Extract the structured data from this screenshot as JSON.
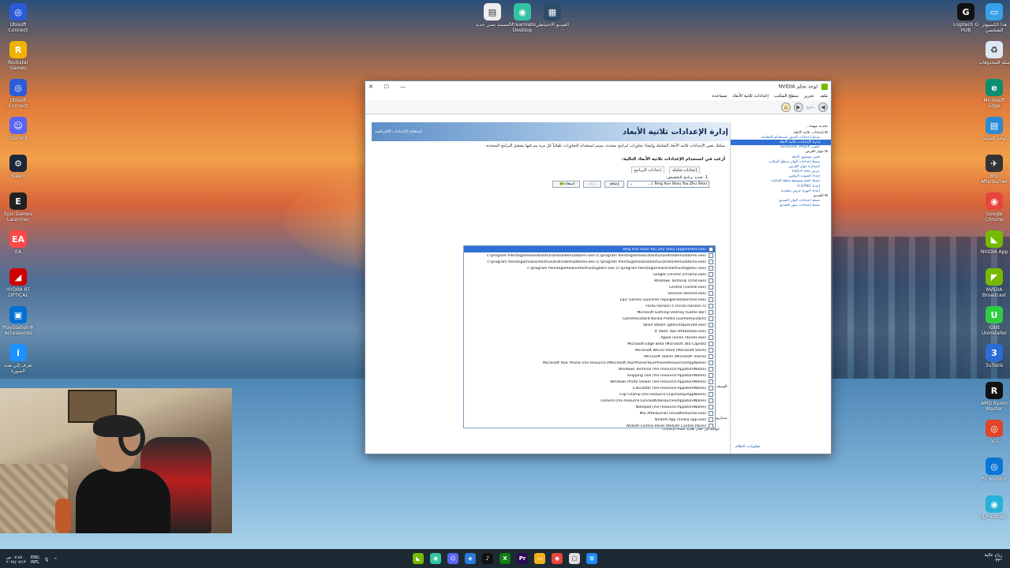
{
  "window": {
    "title": "NVIDIA لوحة تحكم",
    "menu": [
      "ملف",
      "تحرير",
      "سطح المكتب",
      "إعدادات ثلاثية الأبعاد",
      "مساعدة"
    ],
    "toolbar_back": "رجوع",
    "right_pane": {
      "header": "تحديد مهمة...",
      "tree": [
        {
          "label": "إعدادات ثلاثية الأبعاد",
          "type": "cat"
        },
        {
          "label": "ضبط إعدادات الصور باستخدام المعاينة",
          "type": "link"
        },
        {
          "label": "إدارة الإعدادات ثلاثية الأبعاد",
          "type": "sel"
        },
        {
          "label": "تكوين Surround, PhysX",
          "type": "link"
        },
        {
          "label": "جهاز العرض",
          "type": "cat"
        },
        {
          "label": "تغيير مستوى الدقة",
          "type": "link"
        },
        {
          "label": "ضبط إعدادات ألوان سطح المكتب",
          "type": "link"
        },
        {
          "label": "استدارة جهاز العرض",
          "type": "link"
        },
        {
          "label": "عرض حالة HDCP",
          "type": "link"
        },
        {
          "label": "إعداد الصوت الرقمي",
          "type": "link"
        },
        {
          "label": "ضبط حجم وموضع سطح المكتب",
          "type": "link"
        },
        {
          "label": "إعداد G-SYNC",
          "type": "link"
        },
        {
          "label": "إعداد أجهزة عرض متعددة",
          "type": "link"
        },
        {
          "label": "الفيديو",
          "type": "cat"
        },
        {
          "label": "ضبط إعدادات ألوان الفيديو",
          "type": "link"
        },
        {
          "label": "ضبط إعدادات صور الفيديو",
          "type": "link"
        }
      ],
      "system_info": "معلومات النظام"
    },
    "main": {
      "title": "إدارة الإعدادات ثلاثية الأبعاد",
      "restore": "استعادة الإعدادات الافتراضية",
      "description": "يمكنك تغيير الإعدادات ثلاثية الأبعاد الشاملة وإنشاء تجاوزات لبرامج محددة. سيتم استخدام التجاوزات تلقائياً كل مرة يتم فيها تشغيل البرامج المحددة.",
      "question": "أرغب في استخدام الإعدادات ثلاثية الأبعاد التالية:",
      "tabs": [
        "إعدادات شاملة",
        "إعدادات البرنامج"
      ],
      "step1": "1. تحديد برنامج للتخصيص:",
      "selected_program": "Teng Xun Shou You Zhu Shou (...",
      "buttons": {
        "add": "إضافة",
        "remove": "إزالة",
        "restore": "استعادة"
      },
      "side_labels": {
        "desc": "الوصف:",
        "scenario": "سيناريوهات نموذجية:",
        "hint": "لتوجيه في خلال تحديد عمدة الإعدادات."
      },
      "programs": [
        "Teng Xun Shou You Zhu Shou (appmarket.exe)",
        "c:\\program files\\txgameassistant\\ui\\androidemulatoren.exe (c:\\program files\\txgameassistant\\ui\\androidemulatoren.exe)",
        "c:\\program files\\txgameassistant\\ui\\androidemulatorex.exe (c:\\program files\\txgameassistant\\ui\\androidemulatorex.exe)",
        "c:\\program files\\txgameassistant\\ui\\txgadcc.exe (c:\\program files\\txgameassistant\\ui\\txgadcc.exe)",
        "Google Chrome (chrome.exe)",
        "Windows Terminal (cmd.exe)",
        "Control (control.exe)",
        "Discord (discord.exe)",
        "Epic Games Launcher (epicgameslauncher.exe)",
        "Forza Horizon 5 (Forza Horizon 5)",
        "Microsoft Gaming Overlay (Game Bar)",
        "GameAssistant Nvidia Profile (GameAssistant)",
        "Valve Steam (gldriverquery64.exe)",
        "It Takes Two (ittakestwo.exe)",
        "Apple iTunes (itunes.exe)",
        "Microsoft Edge Beta (Microsoft 365 Copilot)",
        "Microsoft Win10 Store (Microsoft Store)",
        "Microsoft Teams (Microsoft Teams)",
        "Microsoft Your Phone (ms-resource://Microsoft.YourPhone/YourPhone/Resources/AppName)",
        "Windows Terminal (ms-resource:AppStoreName)",
        "Snipping Tool (ms-resource:AppStoreName)",
        "Windows Photo Viewer (ms-resource:AppStoreName)",
        "Calculator (ms-resource:AppStoreName)",
        "Clip Champ (ms-resource:Clipchamp/AppName)",
        "Camera (ms-resource:LensSDK/Resources/AppStoreName)",
        "Notepad (ms-resource:AppStoreName)",
        "MSI Afterburner (msiafterburner.exe)",
        "NVIDIA App (nvidia app.exe)",
        "NVIDIA Control Panel (NVIDIA Control Panel)"
      ]
    }
  },
  "desktop_left": [
    {
      "label": "Ubisoft Connect",
      "icon": "ubisoft-icon",
      "color": "#2b5bd7",
      "glyph": "◎"
    },
    {
      "label": "Rockstar Games",
      "icon": "rockstar-icon",
      "color": "#f2b300",
      "glyph": "R"
    },
    {
      "label": "Ubisoft Connect",
      "icon": "ubisoft-icon",
      "color": "#2b5bd7",
      "glyph": "◎"
    },
    {
      "label": "Discord",
      "icon": "discord-icon",
      "color": "#5865f2",
      "glyph": "☺"
    },
    {
      "label": "Steam",
      "icon": "steam-icon",
      "color": "#1b2838",
      "glyph": "⚙"
    },
    {
      "label": "Epic Games Launcher",
      "icon": "epic-icon",
      "color": "#222",
      "glyph": "E"
    },
    {
      "label": "EA",
      "icon": "ea-icon",
      "color": "#ff4747",
      "glyph": "EA"
    },
    {
      "label": "HYDRA RT OPTICAL",
      "icon": "hydra-icon",
      "color": "#c00",
      "glyph": "◢"
    },
    {
      "label": "PlayStation® Accessories",
      "icon": "playstation-icon",
      "color": "#0070d1",
      "glyph": "▣"
    },
    {
      "label": "تعرف إلى هذه الصورة",
      "icon": "spotlight-icon",
      "color": "#1e90ff",
      "glyph": "i"
    }
  ],
  "desktop_top": [
    {
      "label": "مستند نصي جديد",
      "icon": "document-icon",
      "color": "#eee",
      "glyph": "▤"
    },
    {
      "label": "Streamlabs Desktop",
      "icon": "streamlabs-icon",
      "color": "#31c3a2",
      "glyph": "◉"
    },
    {
      "label": "الفيديو الاحتياطي",
      "icon": "video-icon",
      "color": "#2d4b6b",
      "glyph": "▦"
    }
  ],
  "desktop_right": [
    {
      "label": "هذا الكمبيوتر الشخصي",
      "icon": "pc-icon",
      "color": "#3aa0e8",
      "glyph": "▭"
    },
    {
      "label": "Logitech G HUB",
      "icon": "logitech-icon",
      "color": "#111",
      "glyph": "G"
    },
    {
      "label": "سلة المحذوفات",
      "icon": "recycle-bin-icon",
      "color": "#dde8f2",
      "glyph": "♻"
    },
    {
      "label": "Microsoft Edge",
      "icon": "edge-icon",
      "color": "#0c8f6e",
      "glyph": "e"
    },
    {
      "label": "لوحة التحكم",
      "icon": "control-panel-icon",
      "color": "#2a8bd5",
      "glyph": "▤"
    },
    {
      "label": "MSI Afterburner",
      "icon": "afterburner-icon",
      "color": "#333",
      "glyph": "✈"
    },
    {
      "label": "Google Chrome",
      "icon": "chrome-icon",
      "color": "#e8453c",
      "glyph": "◉"
    },
    {
      "label": "NVIDIA App",
      "icon": "nvidia-icon",
      "color": "#76b900",
      "glyph": "◣"
    },
    {
      "label": "NVIDIA Broadcast",
      "icon": "nvidia-broadcast-icon",
      "color": "#76b900",
      "glyph": "◤"
    },
    {
      "label": "IObit Uninstaller",
      "icon": "iobit-icon",
      "color": "#2ecc40",
      "glyph": "U"
    },
    {
      "label": "3uTools",
      "icon": "3utools-icon",
      "color": "#2b6cd8",
      "glyph": "3"
    },
    {
      "label": "AMD Ryzen Master",
      "icon": "ryzen-icon",
      "color": "#111",
      "glyph": "R"
    },
    {
      "label": "GCC",
      "icon": "gcc-icon",
      "color": "#e0452a",
      "glyph": "◎"
    },
    {
      "label": "PC Monitor",
      "icon": "pc-monitor-icon",
      "color": "#0a76d6",
      "glyph": "◎"
    },
    {
      "label": "GLP_install...",
      "icon": "installer-icon",
      "color": "#27b2d8",
      "glyph": "◉"
    }
  ],
  "taskbar": {
    "apps": [
      {
        "icon": "nvidia-taskbar-icon",
        "color": "#76b900",
        "glyph": "◣"
      },
      {
        "icon": "streamlabs-taskbar-icon",
        "color": "#31c3a2",
        "glyph": "◉"
      },
      {
        "icon": "discord-taskbar-icon",
        "color": "#5865f2",
        "glyph": "☺"
      },
      {
        "icon": "vpn-taskbar-icon",
        "color": "#2a7ad6",
        "glyph": "◈"
      },
      {
        "icon": "tiktok-taskbar-icon",
        "color": "#111",
        "glyph": "♪"
      },
      {
        "icon": "xbox-taskbar-icon",
        "color": "#107c10",
        "glyph": "X"
      },
      {
        "icon": "premiere-taskbar-icon",
        "color": "#2a0a55",
        "glyph": "Pr"
      },
      {
        "icon": "file-explorer-taskbar-icon",
        "color": "#f2b01e",
        "glyph": "▭"
      },
      {
        "icon": "chrome-taskbar-icon",
        "color": "#e8453c",
        "glyph": "◉"
      },
      {
        "icon": "window-taskbar-icon",
        "color": "#ddd",
        "glyph": "▢"
      },
      {
        "icon": "start-icon",
        "color": "#1a8cff",
        "glyph": "⊞"
      }
    ],
    "lang": "ENG",
    "lang2": "INTL",
    "time": "٠٧:٤٥ ص",
    "date": "٢٠٢٥/٠٧/١٣",
    "weather": "رياح عالية",
    "weather2": "٣٣°"
  }
}
